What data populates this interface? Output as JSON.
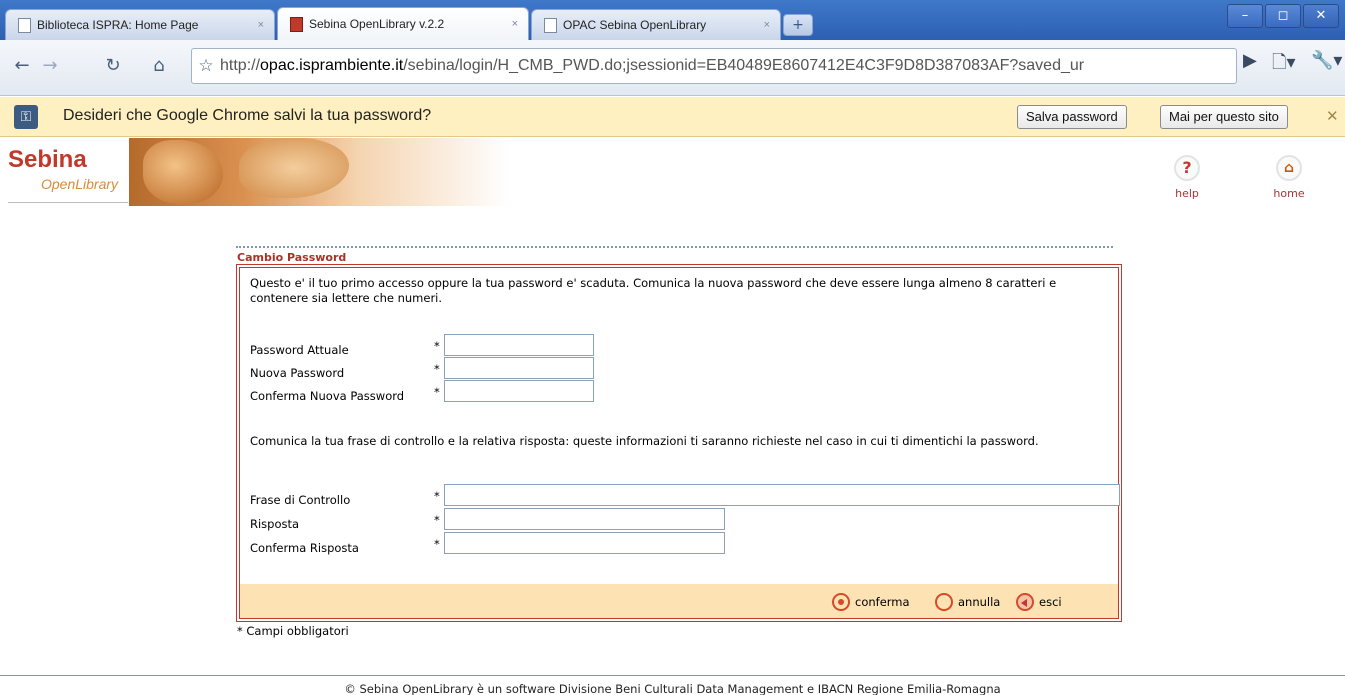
{
  "browser": {
    "tabs": [
      {
        "label": "Biblioteca ISPRA: Home Page",
        "close": "×"
      },
      {
        "label": "Sebina OpenLibrary v.2.2",
        "close": "×"
      },
      {
        "label": "OPAC Sebina OpenLibrary",
        "close": "×"
      }
    ],
    "new_tab": "+",
    "window_buttons": {
      "minimize": "–",
      "maximize": "◻",
      "close": "✕"
    },
    "nav": {
      "back": "←",
      "forward": "→",
      "reload": "↻",
      "home": "⌂",
      "star": "☆"
    },
    "url_prefix": "http://",
    "url_host": "opac.isprambiente.it",
    "url_path": "/sebina/login/H_CMB_PWD.do;jsessionid=EB40489E8607412E4C3F9D8D387083AF?saved_ur",
    "go": "▶",
    "page_menu": "🗋▾",
    "wrench_menu": "🔧▾"
  },
  "infobar": {
    "message": "Desideri che Google Chrome salvi la tua password?",
    "save_button": "Salva password",
    "never_button": "Mai per questo sito",
    "close": "✕"
  },
  "header": {
    "logo_main": "Sebina",
    "logo_sub": "OpenLibrary",
    "help_glyph": "?",
    "help_label": "help",
    "home_glyph": "⌂",
    "home_label": "home"
  },
  "form": {
    "title": "Cambio Password",
    "intro": "Questo e' il tuo primo accesso oppure la tua password e' scaduta. Comunica la nuova password che deve essere lunga almeno 8 caratteri e contenere sia lettere che numeri.",
    "fields_password": [
      {
        "label": "Password Attuale",
        "value": ""
      },
      {
        "label": "Nuova Password",
        "value": ""
      },
      {
        "label": "Conferma Nuova Password",
        "value": ""
      }
    ],
    "question_intro": "Comunica la tua frase di controllo e la relativa risposta: queste informazioni ti saranno richieste nel caso in cui ti dimentichi la password.",
    "fields_question": [
      {
        "label": "Frase di Controllo",
        "value": ""
      },
      {
        "label": "Risposta",
        "value": ""
      },
      {
        "label": "Conferma Risposta",
        "value": ""
      }
    ],
    "asterisk": "*",
    "actions": {
      "confirm": "conferma",
      "cancel": "annulla",
      "exit": "esci"
    },
    "required_note": "* Campi obbligatori"
  },
  "footer": {
    "copyright": "© Sebina OpenLibrary è un software  Divisione Beni Culturali Data Management  e  IBACN Regione Emilia-Romagna"
  }
}
